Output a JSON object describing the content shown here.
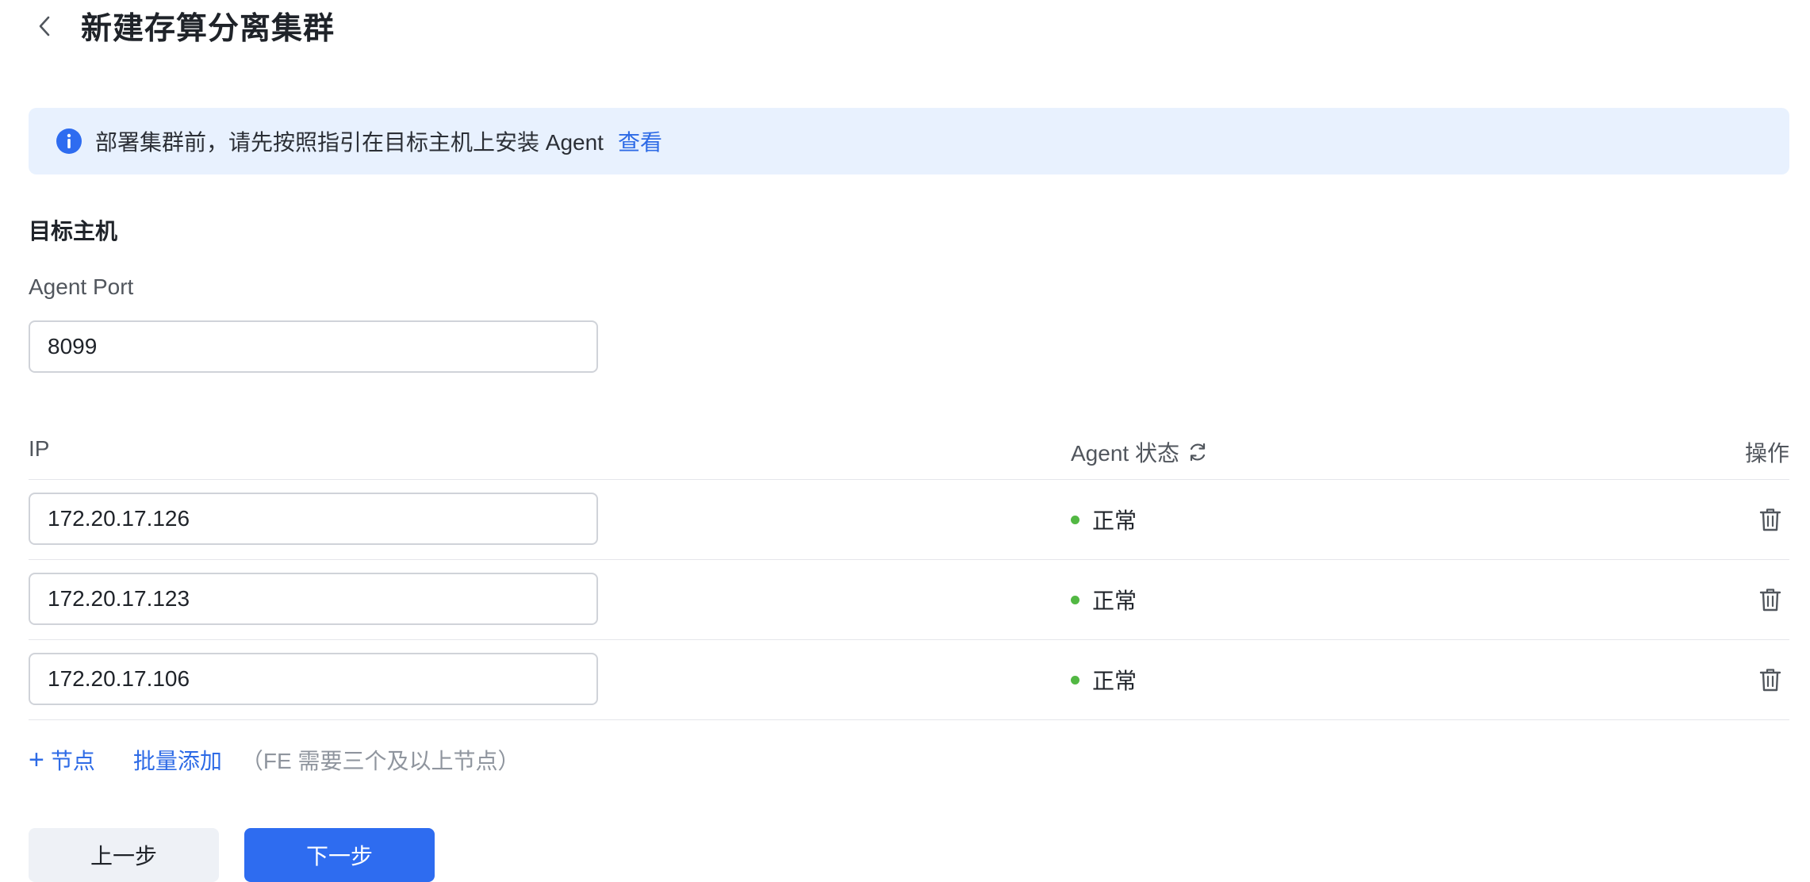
{
  "header": {
    "title": "新建存算分离集群",
    "back_icon": "chevron-left-icon"
  },
  "alert": {
    "icon": "info-icon",
    "text": "部署集群前，请先按照指引在目标主机上安装 Agent",
    "link_label": "查看"
  },
  "section": {
    "title": "目标主机"
  },
  "agent_port": {
    "label": "Agent Port",
    "value": "8099"
  },
  "table": {
    "columns": {
      "ip": "IP",
      "status": "Agent 状态",
      "action": "操作"
    },
    "rows": [
      {
        "ip": "172.20.17.126",
        "status": "正常"
      },
      {
        "ip": "172.20.17.123",
        "status": "正常"
      },
      {
        "ip": "172.20.17.106",
        "status": "正常"
      }
    ]
  },
  "actions": {
    "add_node_label": "节点",
    "batch_add_label": "批量添加",
    "hint": "（FE 需要三个及以上节点）"
  },
  "footer": {
    "prev_label": "上一步",
    "next_label": "下一步"
  },
  "colors": {
    "primary": "#2e6cf0",
    "link": "#2e6be6",
    "alert_bg": "#e8f1fe",
    "status_ok": "#52b843"
  }
}
